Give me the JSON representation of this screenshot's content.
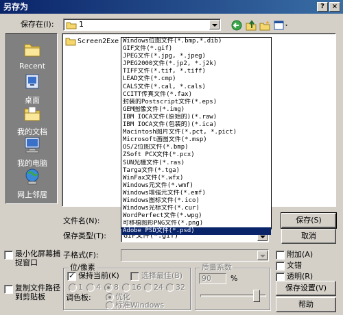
{
  "title": "另存为",
  "titlebar_help": "?",
  "titlebar_close": "×",
  "save_in_label": "保存在(I):",
  "save_in_value": "1",
  "places": [
    {
      "label": "Recent",
      "icon": "recent-folder-icon"
    },
    {
      "label": "桌面",
      "icon": "desktop-icon"
    },
    {
      "label": "我的文档",
      "icon": "my-documents-icon"
    },
    {
      "label": "我的电脑",
      "icon": "my-computer-icon"
    },
    {
      "label": "网上邻居",
      "icon": "network-places-icon"
    }
  ],
  "files": [
    {
      "name": "Screen2Exe",
      "icon": "folder-icon"
    }
  ],
  "filetype_list": [
    "Windows位图文件(*.bmp,*.dib)",
    "GIF文件(*.gif)",
    "JPEG文件(*.jpg, *.jpeg)",
    "JPEG2000文件(*.jp2, *.j2k)",
    "TIFF文件(*.tif, *.tiff)",
    "LEAD文件(*.cmp)",
    "CALS文件(*.cal, *.cals)",
    "CCITT传真文件(*.fax)",
    "封装的Postscript文件(*.eps)",
    "GEM图像文件(*.img)",
    "IBM IOCA文件(原始的)(*.raw)",
    "IBM IOCA文件(包装的)(*.ica)",
    "Macintosh图片文件(*.pct, *.pict)",
    "Microsoft画图文件(*.msp)",
    "OS/2位图文件(*.bmp)",
    "ZSoft PCX文件(*.pcx)",
    "SUN光栅文件(*.ras)",
    "Targa文件(*.tga)",
    "WinFax文件(*.wfx)",
    "Windows元文件(*.wmf)",
    "Windows增强元文件(*.emf)",
    "Windows图标文件(*.ico)",
    "Windows光标文件(*.cur)",
    "WordPerfect文件(*.wpg)",
    "可移植图形PNG文件(*.png)",
    "Adobe PSD文件(*.psd)"
  ],
  "filetype_selected_index": 25,
  "filename_label": "文件名(N):",
  "filetype_label": "保存类型(T):",
  "filetype_value": "GIF文件(*.gif)",
  "save_button": "保存(S)",
  "cancel_button": "取消",
  "subformat_label": "子格式(F):",
  "minimize_label_1": "最小化屏幕捕",
  "minimize_label_2": "捉窗口",
  "copy_label_1": "复制文件路径",
  "copy_label_2": "到剪贴板",
  "bitdepth_group": "位/像素",
  "keep_current": "保持当前(K)",
  "choose_best": "选择最佳(B)",
  "bit_options": [
    "1",
    "4",
    "8",
    "16",
    "24",
    "32"
  ],
  "palette_label": "调色板:",
  "palette_optimize": "优化",
  "palette_standard": "标准Windows",
  "quality_group": "质量系数",
  "quality_value": "90",
  "quality_unit": "%",
  "append_label": "附加(A)",
  "text_label": "文错",
  "transparent_label": "透明(R)",
  "save_settings_button": "保存设置(V)",
  "help_button": "帮助",
  "colors": {
    "title_start": "#0a246a",
    "title_end": "#3a6ea5",
    "face": "#d4d0c8",
    "selection": "#0a246a"
  }
}
